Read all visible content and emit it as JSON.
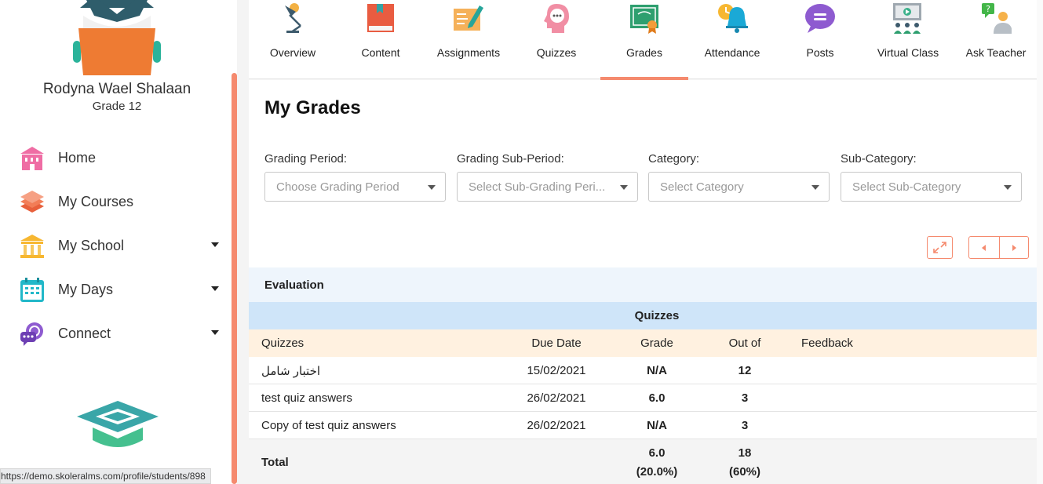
{
  "profile": {
    "name": "Rodyna Wael Shalaan",
    "grade": "Grade 12"
  },
  "sidebar": {
    "items": [
      {
        "label": "Home",
        "icon": "home-icon",
        "has_dropdown": false
      },
      {
        "label": "My Courses",
        "icon": "books-icon",
        "has_dropdown": false
      },
      {
        "label": "My School",
        "icon": "school-building-icon",
        "has_dropdown": true
      },
      {
        "label": "My Days",
        "icon": "calendar-icon",
        "has_dropdown": true
      },
      {
        "label": "Connect",
        "icon": "chat-connect-icon",
        "has_dropdown": true
      }
    ]
  },
  "status_url": "https://demo.skoleralms.com/profile/students/898",
  "tabs": [
    {
      "label": "Overview",
      "icon": "desk-lamp-icon"
    },
    {
      "label": "Content",
      "icon": "book-icon"
    },
    {
      "label": "Assignments",
      "icon": "pen-paper-icon"
    },
    {
      "label": "Quizzes",
      "icon": "head-thought-icon"
    },
    {
      "label": "Grades",
      "icon": "certificate-icon",
      "active": true
    },
    {
      "label": "Attendance",
      "icon": "bell-clock-icon"
    },
    {
      "label": "Posts",
      "icon": "speech-bubble-icon"
    },
    {
      "label": "Virtual Class",
      "icon": "presentation-screen-icon"
    },
    {
      "label": "Ask Teacher",
      "icon": "question-person-icon"
    }
  ],
  "main": {
    "title": "My Grades",
    "filters": [
      {
        "label": "Grading Period:",
        "placeholder": "Choose Grading Period"
      },
      {
        "label": "Grading Sub-Period:",
        "placeholder": "Select Sub-Grading Peri..."
      },
      {
        "label": "Category:",
        "placeholder": "Select Category"
      },
      {
        "label": "Sub-Category:",
        "placeholder": "Select Sub-Category"
      }
    ],
    "evaluation_label": "Evaluation",
    "section_label": "Quizzes",
    "table": {
      "headers": {
        "name": "Quizzes",
        "due": "Due Date",
        "grade": "Grade",
        "out_of": "Out of",
        "feedback": "Feedback"
      },
      "rows": [
        {
          "name": "اختبار شامل",
          "due": "15/02/2021",
          "grade": "N/A",
          "out_of": "12"
        },
        {
          "name": "test quiz answers",
          "due": "26/02/2021",
          "grade": "6.0",
          "out_of": "3"
        },
        {
          "name": "Copy of test quiz answers",
          "due": "26/02/2021",
          "grade": "N/A",
          "out_of": "3"
        }
      ],
      "total": {
        "label": "Total",
        "grade": "6.0",
        "grade_pct": "(20.0%)",
        "out_of": "18",
        "out_of_pct": "(60%)"
      }
    }
  },
  "colors": {
    "accent": "#f58a6e",
    "eval_bg": "#eef5fc",
    "section_bg": "#cfe5f9",
    "header_bg": "#fff1e0"
  }
}
